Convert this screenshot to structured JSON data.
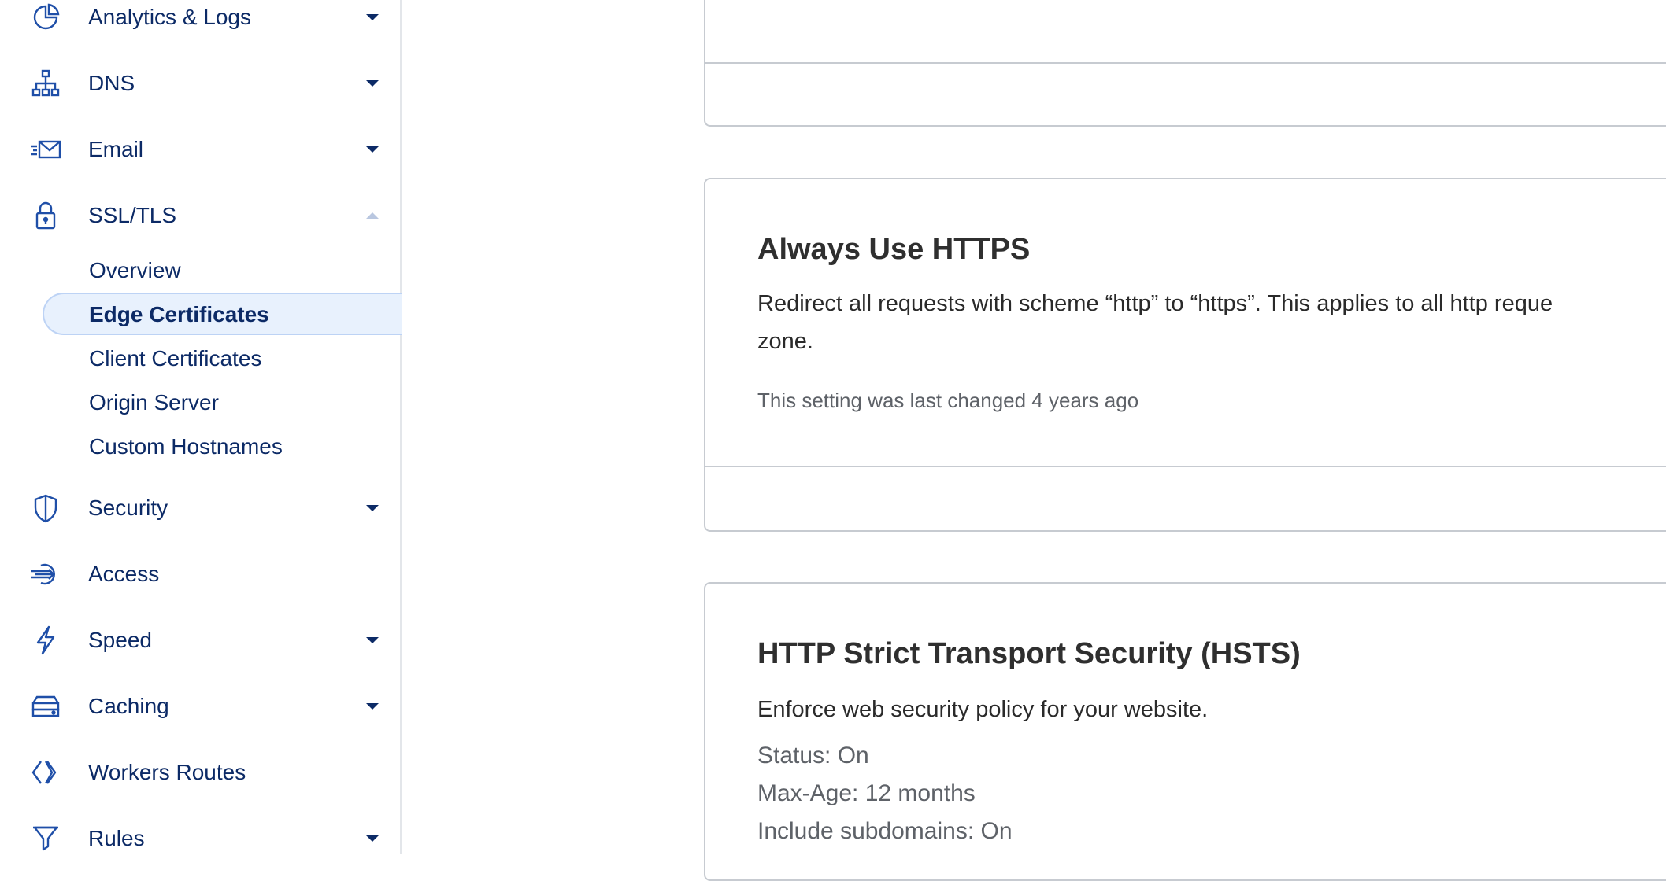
{
  "sidebar": {
    "items": [
      {
        "label": "Analytics & Logs",
        "icon": "pie-chart-icon",
        "chevron": "down"
      },
      {
        "label": "DNS",
        "icon": "network-tree-icon",
        "chevron": "down"
      },
      {
        "label": "Email",
        "icon": "envelope-icon",
        "chevron": "down"
      },
      {
        "label": "SSL/TLS",
        "icon": "lock-icon",
        "chevron": "up"
      },
      {
        "label": "Security",
        "icon": "shield-icon",
        "chevron": "down"
      },
      {
        "label": "Access",
        "icon": "access-icon",
        "chevron": "none"
      },
      {
        "label": "Speed",
        "icon": "lightning-icon",
        "chevron": "down"
      },
      {
        "label": "Caching",
        "icon": "server-stack-icon",
        "chevron": "down"
      },
      {
        "label": "Workers Routes",
        "icon": "workers-icon",
        "chevron": "none"
      },
      {
        "label": "Rules",
        "icon": "funnel-icon",
        "chevron": "down"
      }
    ],
    "ssl_subitems": [
      {
        "label": "Overview"
      },
      {
        "label": "Edge Certificates",
        "active": true
      },
      {
        "label": "Client Certificates"
      },
      {
        "label": "Origin Server"
      },
      {
        "label": "Custom Hostnames"
      }
    ]
  },
  "cards": {
    "always_https": {
      "title": "Always Use HTTPS",
      "desc_line1": "Redirect all requests with scheme “http” to “https”. This applies to all http reque",
      "desc_line2": "zone.",
      "meta": "This setting was last changed 4 years ago"
    },
    "hsts": {
      "title": "HTTP Strict Transport Security (HSTS)",
      "desc": "Enforce web security policy for your website.",
      "status": "Status: On",
      "max_age": "Max-Age: 12 months",
      "include_subdomains": "Include subdomains: On"
    }
  },
  "colors": {
    "nav_text": "#0c2a66",
    "active_bg": "#e8f1fd",
    "card_border": "#c7cbd1"
  }
}
